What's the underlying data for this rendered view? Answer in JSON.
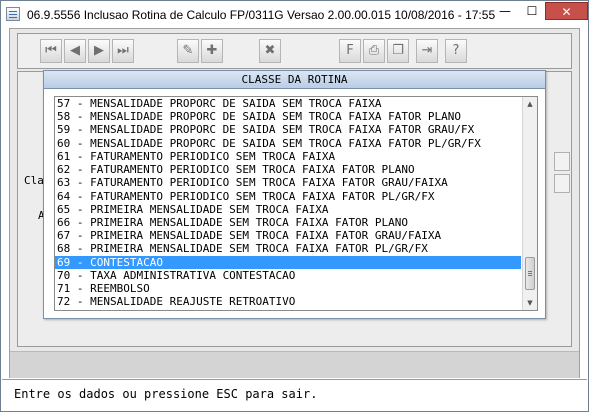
{
  "window": {
    "title": "06.9.5556  Inclusao  Rotina de Calculo FP/0311G Versao 2.00.00.015 10/08/2016 - 17:55",
    "min_glyph": "—",
    "max_glyph": "☐",
    "close_glyph": "✕"
  },
  "toolbar": {
    "first": "⏮",
    "prev": "◀",
    "next": "▶",
    "last": "⏭",
    "edit": "✎",
    "add": "✚",
    "delete": "✖",
    "filter": "F",
    "print": "⎙",
    "copy": "❐",
    "exit": "⇥",
    "help": "?"
  },
  "background": {
    "label_cla": "Cla",
    "label_a": "A"
  },
  "dialog": {
    "title": "CLASSE DA ROTINA",
    "items": [
      "57 - MENSALIDADE PROPORC DE SAIDA SEM TROCA FAIXA",
      "58 - MENSALIDADE PROPORC DE SAIDA SEM TROCA FAIXA FATOR PLANO",
      "59 - MENSALIDADE PROPORC DE SAIDA SEM TROCA FAIXA FATOR GRAU/FX",
      "60 - MENSALIDADE PROPORC DE SAIDA SEM TROCA FAIXA FATOR PL/GR/FX",
      "61 - FATURAMENTO PERIODICO SEM TROCA FAIXA",
      "62 - FATURAMENTO PERIODICO SEM TROCA FAIXA FATOR PLANO",
      "63 - FATURAMENTO PERIODICO SEM TROCA FAIXA FATOR GRAU/FAIXA",
      "64 - FATURAMENTO PERIODICO SEM TROCA FAIXA FATOR PL/GR/FX",
      "65 - PRIMEIRA MENSALIDADE SEM TROCA FAIXA",
      "66 - PRIMEIRA MENSALIDADE SEM TROCA FAIXA FATOR PLANO",
      "67 - PRIMEIRA MENSALIDADE SEM TROCA FAIXA FATOR GRAU/FAIXA",
      "68 - PRIMEIRA MENSALIDADE SEM TROCA FAIXA FATOR PL/GR/FX",
      "69 - CONTESTACAO",
      "70 - TAXA ADMINISTRATIVA CONTESTACAO",
      "71 - REEMBOLSO",
      "72 - MENSALIDADE REAJUSTE RETROATIVO"
    ],
    "selected_item": "69 - CONTESTACAO"
  },
  "status": {
    "message": "Entre os dados ou pressione ESC para sair."
  }
}
